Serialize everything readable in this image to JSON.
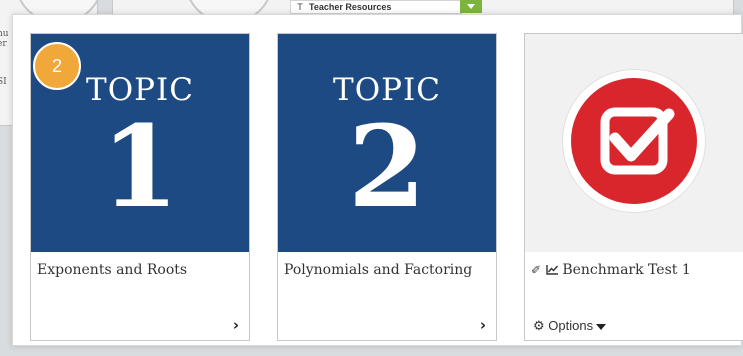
{
  "background": {
    "left_card_text": "nu er",
    "left_card_text2": "SI",
    "resource_row": {
      "type_letter": "T",
      "label": "Teacher Resources"
    }
  },
  "step_badge": "2",
  "cards": [
    {
      "tile_word": "TOPIC",
      "tile_number": "1",
      "title": "Exponents and Roots",
      "action": "›"
    },
    {
      "tile_word": "TOPIC",
      "tile_number": "2",
      "title": "Polynomials and Factoring",
      "action": "›"
    },
    {
      "title": "Benchmark Test 1",
      "options_label": "Options"
    }
  ],
  "colors": {
    "topic_tile": "#1d4a82",
    "benchmark_red": "#d9262c",
    "step_badge": "#f0a83a",
    "dropdown_green": "#7cb53d"
  }
}
